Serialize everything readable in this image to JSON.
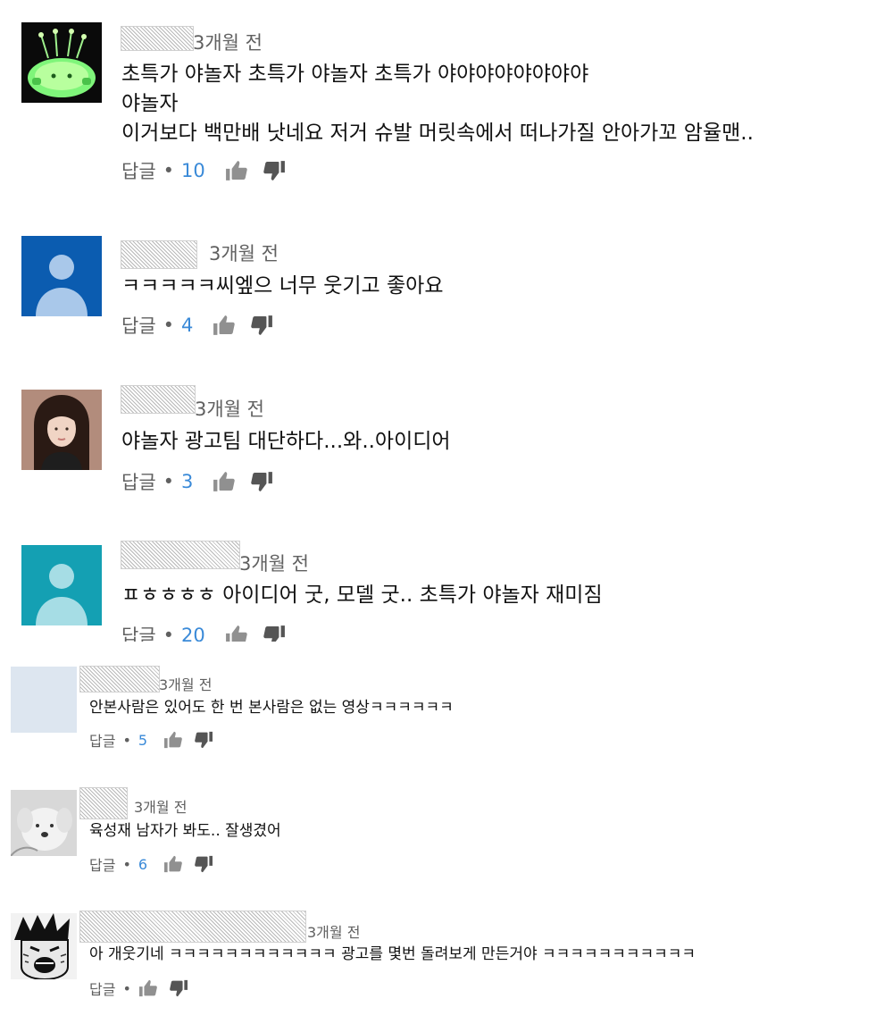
{
  "comments_block1": [
    {
      "avatar": "alien-avatar",
      "time": "3개월 전",
      "lines": [
        "초특가 야놀자 초특가 야놀자 초특가 야야야야야야야야",
        "야놀자",
        "이거보다 백만배 낫네요 저거 슈발 머릿속에서 떠나가질 안아가꼬 암율맨.."
      ],
      "reply": "답글",
      "likes": "10"
    },
    {
      "avatar": "default-avatar-blue",
      "time": "3개월 전",
      "lines": [
        "ㅋㅋㅋㅋㅋ씨엪으 너무 웃기고 좋아요"
      ],
      "reply": "답글",
      "likes": "4"
    },
    {
      "avatar": "photo-avatar-woman",
      "time": "3개월 전",
      "lines": [
        "야놀자 광고팀 대단하다...와..아이디어"
      ],
      "reply": "답글",
      "likes": "3"
    },
    {
      "avatar": "default-avatar-teal",
      "time": "3개월 전",
      "lines": [
        "ㅍㅎㅎㅎㅎ 아이디어 굿, 모델 굿.. 초특가 야놀자 재미짐"
      ],
      "reply": "답글",
      "likes": "20"
    }
  ],
  "comments_block2": [
    {
      "avatar": "blank-avatar",
      "time": "3개월 전",
      "lines": [
        "안본사람은 있어도 한 번 본사람은 없는 영상ㅋㅋㅋㅋㅋㅋ"
      ],
      "reply": "답글",
      "likes": "5"
    },
    {
      "avatar": "dog-avatar",
      "time": "3개월 전",
      "lines": [
        "육성재 남자가 봐도.. 잘생겼어"
      ],
      "reply": "답글",
      "likes": "6"
    },
    {
      "avatar": "manga-avatar",
      "time": "3개월 전",
      "lines": [
        "아 개웃기네 ㅋㅋㅋㅋㅋㅋㅋㅋㅋㅋㅋㅋ 광고를 몇번 돌려보게 만든거야 ㅋㅋㅋㅋㅋㅋㅋㅋㅋㅋㅋ"
      ],
      "reply": "답글",
      "likes": ""
    }
  ],
  "colors": {
    "count_blue": "#3a8ad8",
    "meta_gray": "#606060",
    "avatar_blue": "#0b5cb0",
    "avatar_teal": "#14a0b3"
  }
}
